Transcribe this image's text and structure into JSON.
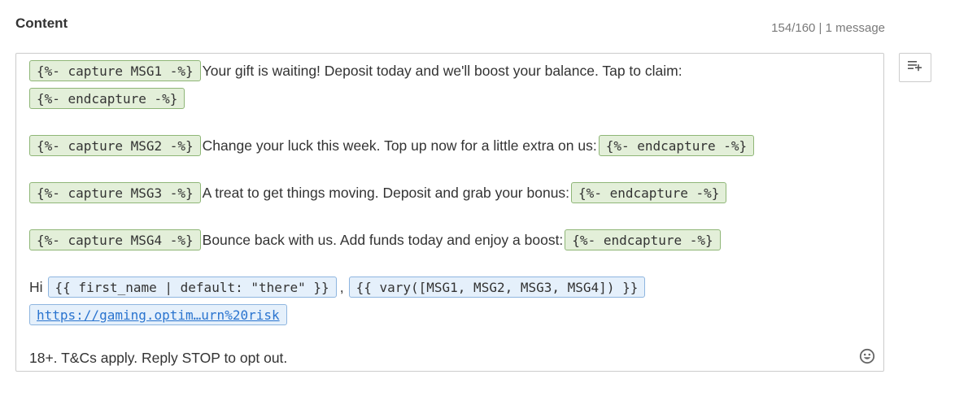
{
  "section": {
    "title": "Content",
    "counter": "154/160 | 1 message"
  },
  "editor": {
    "msg1": {
      "open_tag": "{%- capture MSG1 -%}",
      "text": "Your gift is waiting! Deposit today and we'll boost your balance. Tap to claim:",
      "close_tag": "{%- endcapture -%}"
    },
    "msg2": {
      "open_tag": "{%- capture MSG2 -%}",
      "text": "Change your luck this week. Top up now for a little extra on us:",
      "close_tag": "{%- endcapture -%}"
    },
    "msg3": {
      "open_tag": "{%- capture MSG3 -%}",
      "text": "A treat to get things moving. Deposit and grab your bonus:",
      "close_tag": "{%- endcapture -%}"
    },
    "msg4": {
      "open_tag": "{%- capture MSG4 -%}",
      "text": "Bounce back with us. Add funds today and enjoy a boost:",
      "close_tag": "{%- endcapture -%}"
    },
    "greeting": {
      "hi": "Hi",
      "first_name_tag": "{{ first_name | default: \"there\" }}",
      "comma": ",",
      "vary_tag": "{{ vary([MSG1, MSG2, MSG3, MSG4]) }}"
    },
    "link": "https://gaming.optim…urn%20risk",
    "footer": "18+. T&Cs apply. Reply STOP to opt out."
  },
  "icons": {
    "emoji": "smiley-icon",
    "insert": "playlist-add-icon"
  },
  "colors": {
    "capture_bg": "#e3efd9",
    "capture_border": "#8fb677",
    "var_bg": "#e5f0fb",
    "var_border": "#8eb5df",
    "link": "#2a74cf"
  }
}
